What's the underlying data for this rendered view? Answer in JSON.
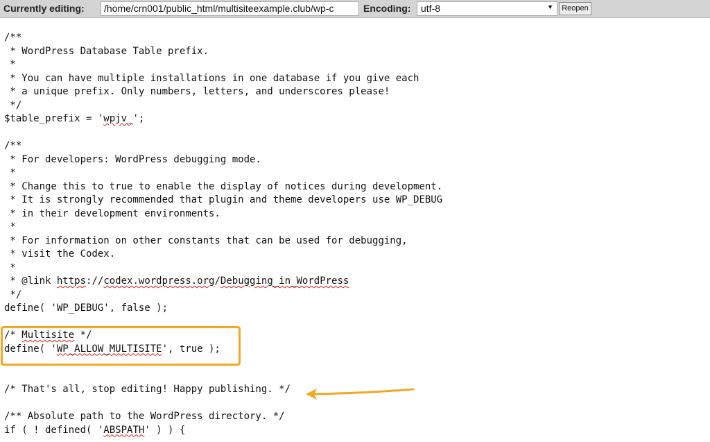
{
  "toolbar": {
    "editing_label": "Currently editing:",
    "path_value": "/home/crn001/public_html/multisiteexample.club/wp-c",
    "encoding_label": "Encoding:",
    "encoding_value": "utf-8",
    "reopen_label": "Reopen"
  },
  "code": {
    "lines": [
      "/**",
      " * WordPress Database Table prefix.",
      " *",
      " * You can have multiple installations in one database if you give each",
      " * a unique prefix. Only numbers, letters, and underscores please!",
      " */",
      "$table_prefix = 'wpjv_';",
      "",
      "/**",
      " * For developers: WordPress debugging mode.",
      " *",
      " * Change this to true to enable the display of notices during development.",
      " * It is strongly recommended that plugin and theme developers use WP_DEBUG",
      " * in their development environments.",
      " *",
      " * For information on other constants that can be used for debugging,",
      " * visit the Codex.",
      " *",
      " * @link https://codex.wordpress.org/Debugging_in_WordPress",
      " */",
      "define( 'WP_DEBUG', false );",
      "",
      "/* Multisite */",
      "define( 'WP_ALLOW_MULTISITE', true );",
      "",
      "",
      "/* That's all, stop editing! Happy publishing. */",
      "",
      "/** Absolute path to the WordPress directory. */",
      "if ( ! defined( 'ABSPATH' ) ) {"
    ],
    "squiggles": [
      "wpjv_",
      "https",
      "codex.wordpress.org",
      "Debugging_in_WordPress",
      "Multisite",
      "WP_ALLOW_MULTISITE",
      "ABSPATH"
    ]
  },
  "annotations": {
    "highlight_color": "#f5a623"
  }
}
